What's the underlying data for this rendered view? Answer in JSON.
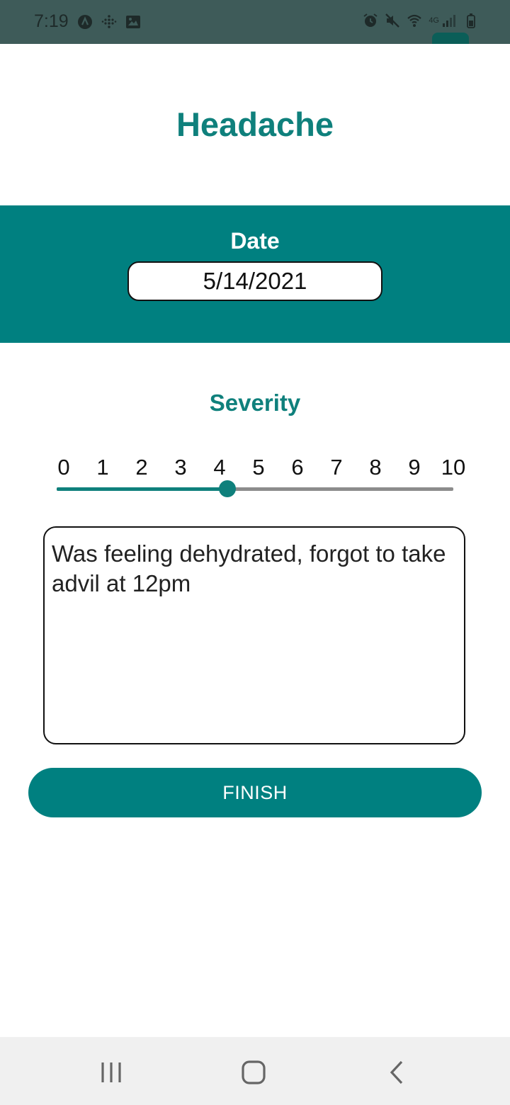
{
  "status_bar": {
    "time": "7:19",
    "left_icons": [
      "app-a-icon",
      "grid-dots-icon",
      "image-icon"
    ],
    "right_icons": [
      "alarm-icon",
      "mute-icon",
      "wifi-icon",
      "signal-icon",
      "battery-icon"
    ],
    "network_label": "4G"
  },
  "page": {
    "title": "Headache"
  },
  "date": {
    "label": "Date",
    "value": "5/14/2021"
  },
  "severity": {
    "label": "Severity",
    "ticks": [
      "0",
      "1",
      "2",
      "3",
      "4",
      "5",
      "6",
      "7",
      "8",
      "9",
      "10"
    ],
    "min": 0,
    "max": 10,
    "value": 4.3
  },
  "notes": {
    "value": "Was feeling dehydrated, forgot to take advil at 12pm"
  },
  "actions": {
    "finish_label": "FINISH"
  },
  "nav_bar": {
    "icons": [
      "recent-apps-icon",
      "home-icon",
      "back-icon"
    ]
  },
  "colors": {
    "accent": "#008080",
    "title": "#0f807c",
    "status_bar": "#3e5b59"
  }
}
